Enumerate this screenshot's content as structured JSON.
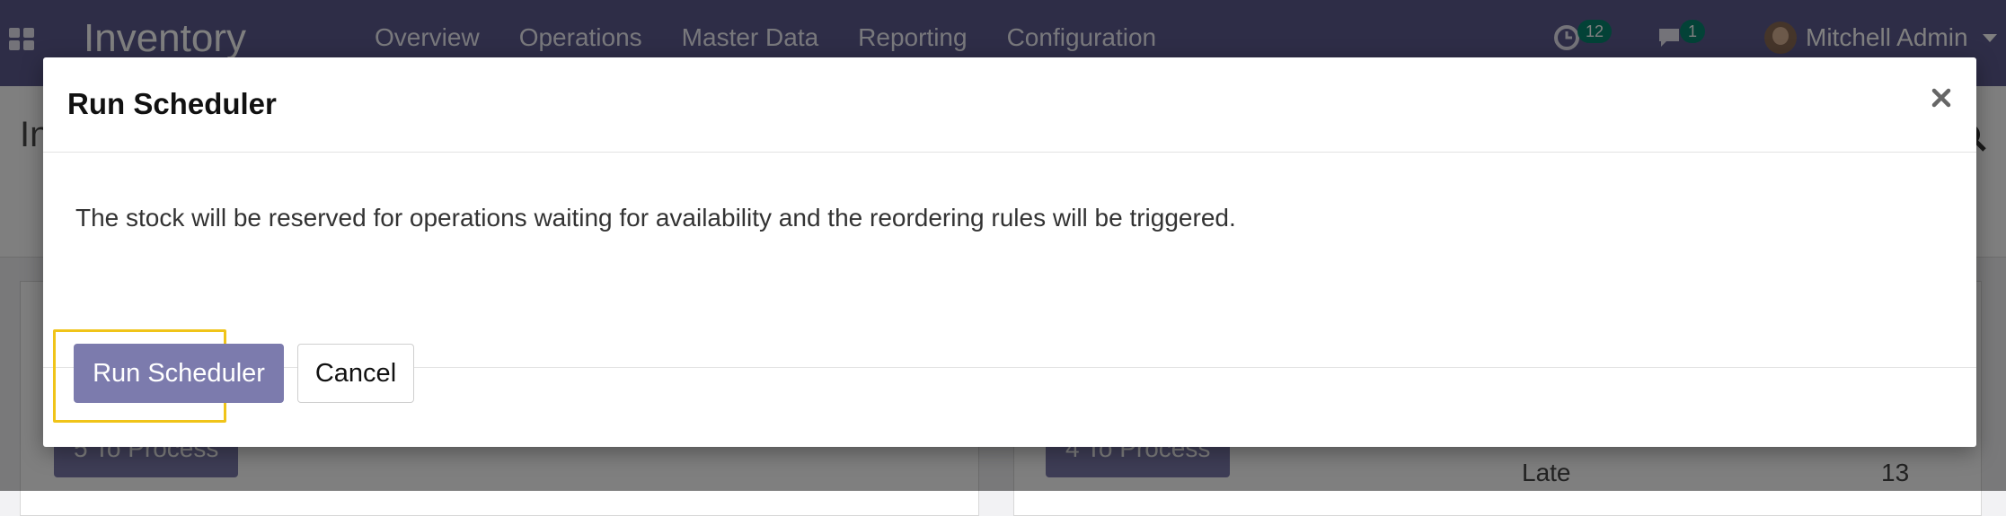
{
  "navbar": {
    "brand": "Inventory",
    "menu": [
      "Overview",
      "Operations",
      "Master Data",
      "Reporting",
      "Configuration"
    ],
    "activity_count": "12",
    "message_count": "1",
    "user_name": "Mitchell Admin"
  },
  "background": {
    "page_title_partial": "In",
    "card_buttons": [
      "5 To Process",
      "4 To Process"
    ],
    "stat_label": "Late",
    "stat_value": "13"
  },
  "modal": {
    "title": "Run Scheduler",
    "close_symbol": "×",
    "body_text": "The stock will be reserved for operations waiting for availability and the reordering rules will be triggered.",
    "primary_button": "Run Scheduler",
    "secondary_button": "Cancel"
  },
  "colors": {
    "navbar": "#5d5a8f",
    "primary": "#7c7bad",
    "badge": "#06856f",
    "highlight": "#f0c419"
  }
}
